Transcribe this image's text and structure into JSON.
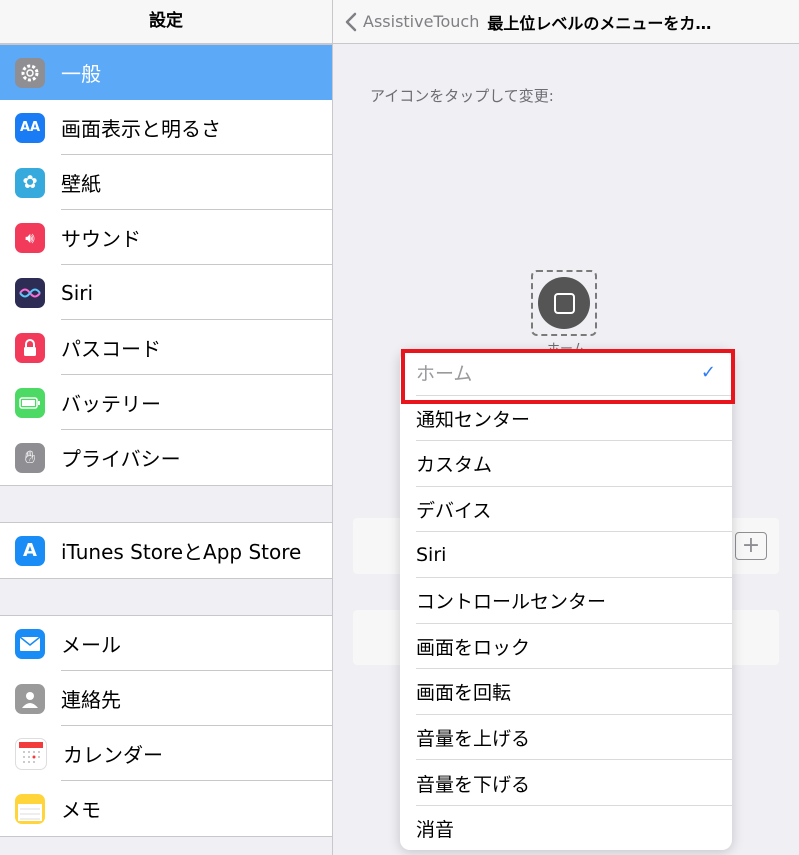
{
  "sidebar": {
    "title": "設定",
    "groups": [
      {
        "items": [
          {
            "label": "一般",
            "icon": "gear-icon",
            "color": "#8e8e93",
            "selected": true
          },
          {
            "label": "画面表示と明るさ",
            "icon": "display-brightness-icon",
            "color": "#1a7cf5"
          },
          {
            "label": "壁紙",
            "icon": "wallpaper-flower-icon",
            "color": "#36aadc"
          },
          {
            "label": "サウンド",
            "icon": "speaker-icon",
            "color": "#f23b5b"
          },
          {
            "label": "Siri",
            "icon": "siri-icon",
            "color": "#2c2c54"
          },
          {
            "label": "パスコード",
            "icon": "lock-icon",
            "color": "#f23b5b"
          },
          {
            "label": "バッテリー",
            "icon": "battery-icon",
            "color": "#4cd964"
          },
          {
            "label": "プライバシー",
            "icon": "hand-icon",
            "color": "#8e8e93"
          }
        ]
      },
      {
        "items": [
          {
            "label": "iTunes StoreとApp Store",
            "icon": "app-store-icon",
            "color": "#1a8cf5"
          }
        ]
      },
      {
        "items": [
          {
            "label": "メール",
            "icon": "mail-icon",
            "color": "#1a8cf5"
          },
          {
            "label": "連絡先",
            "icon": "contacts-icon",
            "color": "#9a9a9a"
          },
          {
            "label": "カレンダー",
            "icon": "calendar-icon",
            "color": "#ffffff"
          },
          {
            "label": "メモ",
            "icon": "notes-icon",
            "color": "#ffd53b"
          }
        ]
      }
    ]
  },
  "detail": {
    "back_label": "AssistiveTouch",
    "title": "最上位レベルのメニューをカ…",
    "hint": "アイコンをタップして変更:",
    "home_caption": "ホーム",
    "plus_label": "+"
  },
  "menu": {
    "items": [
      "ホーム",
      "通知センター",
      "カスタム",
      "デバイス",
      "Siri",
      "コントロールセンター",
      "画面をロック",
      "画面を回転",
      "音量を上げる",
      "音量を下げる",
      "消音"
    ],
    "selected_index": 0,
    "checkmark": "✓",
    "highlight_color": "#e8161c"
  }
}
